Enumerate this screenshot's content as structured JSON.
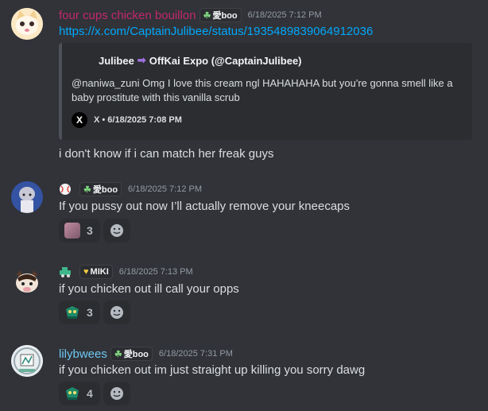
{
  "messages": [
    {
      "username": "four cups chicken bouillon",
      "username_color": "#c2286e",
      "tag": "愛boo",
      "timestamp": "6/18/2025 7:12 PM",
      "link": "https://x.com/CaptainJulibee/status/1935489839064912036",
      "embed": {
        "author_left": "Julibee",
        "author_right": "OffKai Expo (@CaptainJulibee)",
        "description": "@naniwa_zuni Omg I love this cream ngl HAHAHAHA but you're gonna smell like a baby prostitute with this vanilla scrub",
        "footer_icon": "X",
        "footer": "X • 6/18/2025 7:08 PM"
      },
      "text": "i don't know if i can match her freak guys"
    },
    {
      "username": "",
      "tag": "愛boo",
      "timestamp": "6/18/2025 7:12 PM",
      "text": "If you pussy out now I’ll actually remove your kneecaps",
      "reaction_count": "3"
    },
    {
      "username": "",
      "tag": "MIKI",
      "timestamp": "6/18/2025 7:13 PM",
      "text": "if you chicken out ill call your opps",
      "reaction_count": "3"
    },
    {
      "username": "lilybwees",
      "username_color": "#6ec6f0",
      "tag": "愛boo",
      "timestamp": "6/18/2025 7:31 PM",
      "text": "if you chicken out im just straight up killing you sorry dawg",
      "reaction_count": "4"
    }
  ]
}
